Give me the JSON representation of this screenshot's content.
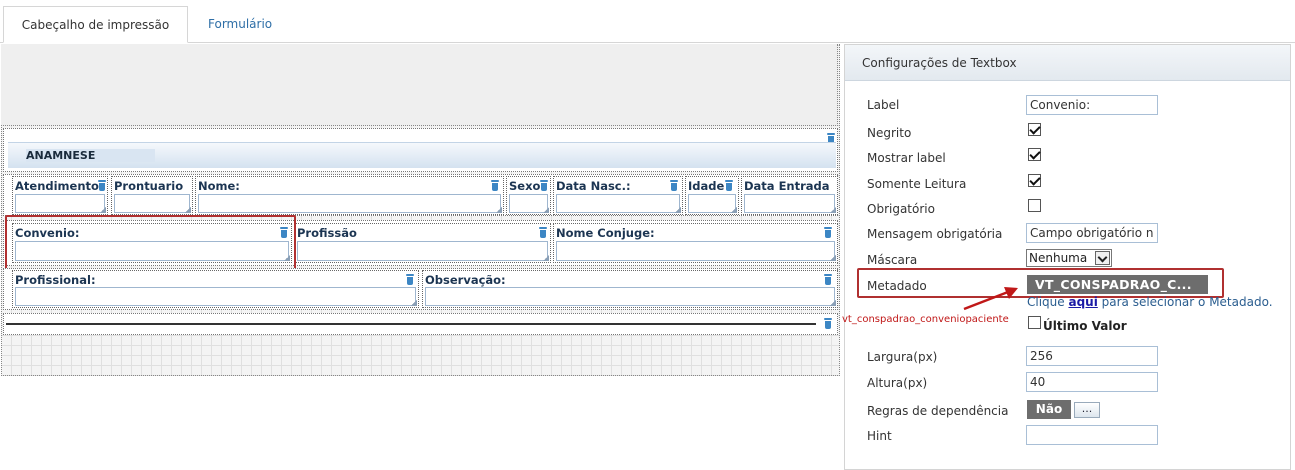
{
  "tabs": {
    "print_header": "Cabeçalho de impressão",
    "form": "Formulário"
  },
  "form": {
    "section_title": "ANAMNESE",
    "fields": {
      "atendimento": "Atendimento",
      "prontuario": "Prontuario",
      "nome": "Nome:",
      "sexo": "Sexo",
      "data_nasc": "Data Nasc.:",
      "idade": "Idade",
      "data_entrada": "Data Entrada",
      "convenio": "Convenio:",
      "profissao": "Profissão",
      "nome_conjuge": "Nome Conjuge:",
      "profissional": "Profissional:",
      "observacao": "Observação:"
    }
  },
  "panel": {
    "title": "Configurações de Textbox",
    "label_label": "Label",
    "label_value": "Convenio:",
    "negrito": "Negrito",
    "negrito_checked": true,
    "mostrar_label": "Mostrar label",
    "mostrar_label_checked": true,
    "somente_leitura": "Somente Leitura",
    "somente_leitura_checked": true,
    "obrigatorio": "Obrigatório",
    "obrigatorio_checked": false,
    "mensagem_obrigatoria": "Mensagem obrigatória",
    "mensagem_obrigatoria_value": "Campo obrigatório n",
    "mascara": "Máscara",
    "mascara_value": "Nenhuma",
    "metadado": "Metadado",
    "metadado_value": "VT_CONSPADRAO_C...",
    "help_prefix": "Clique ",
    "help_link": "aqui",
    "help_suffix": " para selecionar o Metadado.",
    "ultimo_valor": "Último Valor",
    "ultimo_valor_checked": false,
    "largura": "Largura(px)",
    "largura_value": "256",
    "altura": "Altura(px)",
    "altura_value": "40",
    "regras": "Regras de dependência",
    "regras_value": "Não",
    "regras_button": "...",
    "hint": "Hint",
    "hint_value": ""
  },
  "annotation": {
    "text": "vt_conspadrao_conveniopaciente",
    "color": "#c01818"
  },
  "colors": {
    "highlight": "#b03030",
    "field_label": "#1c3552",
    "tab_link": "#2f6fa7",
    "badge": "#6d6d6d"
  }
}
